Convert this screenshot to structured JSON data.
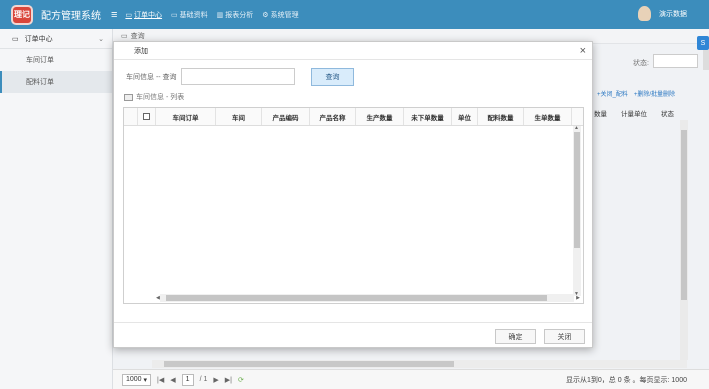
{
  "app": {
    "title": "配方管理系统",
    "logo_text": "理记"
  },
  "topnav": {
    "items": [
      {
        "label": "订单中心",
        "icon": "monitor-icon"
      },
      {
        "label": "基础资料",
        "icon": "monitor-icon"
      },
      {
        "label": "报表分析",
        "icon": "bar-chart-icon"
      },
      {
        "label": "系统管理",
        "icon": "gear-icon"
      }
    ],
    "user_name": "演示数据"
  },
  "sidebar": {
    "group_label": "订单中心",
    "items": [
      {
        "label": "车间订单"
      },
      {
        "label": "配料订单"
      }
    ]
  },
  "main": {
    "tab_label": "查询",
    "status_label": "状态:",
    "links": [
      "+关闭_配料",
      "+删除/批量删除"
    ],
    "headers": [
      "数量",
      "计量单位",
      "状态"
    ]
  },
  "pager": {
    "page_size": "1000",
    "page_current": "1",
    "page_total": "/ 1",
    "info": "显示从1到0，总 0 条 。每页显示:  1000"
  },
  "modal": {
    "title": "添加",
    "search_label": "车间信息 -- 查询",
    "search_value": "",
    "search_button": "查询",
    "list_caption": "车间信息 - 列表",
    "columns": [
      "车间订单",
      "车间",
      "产品编码",
      "产品名称",
      "生产数量",
      "未下单数量",
      "单位",
      "配料数量",
      "生单数量"
    ],
    "confirm_button": "确定",
    "close_button": "关闭"
  },
  "colors": {
    "header": "#3c8dbc",
    "link": "#2b78c2"
  }
}
